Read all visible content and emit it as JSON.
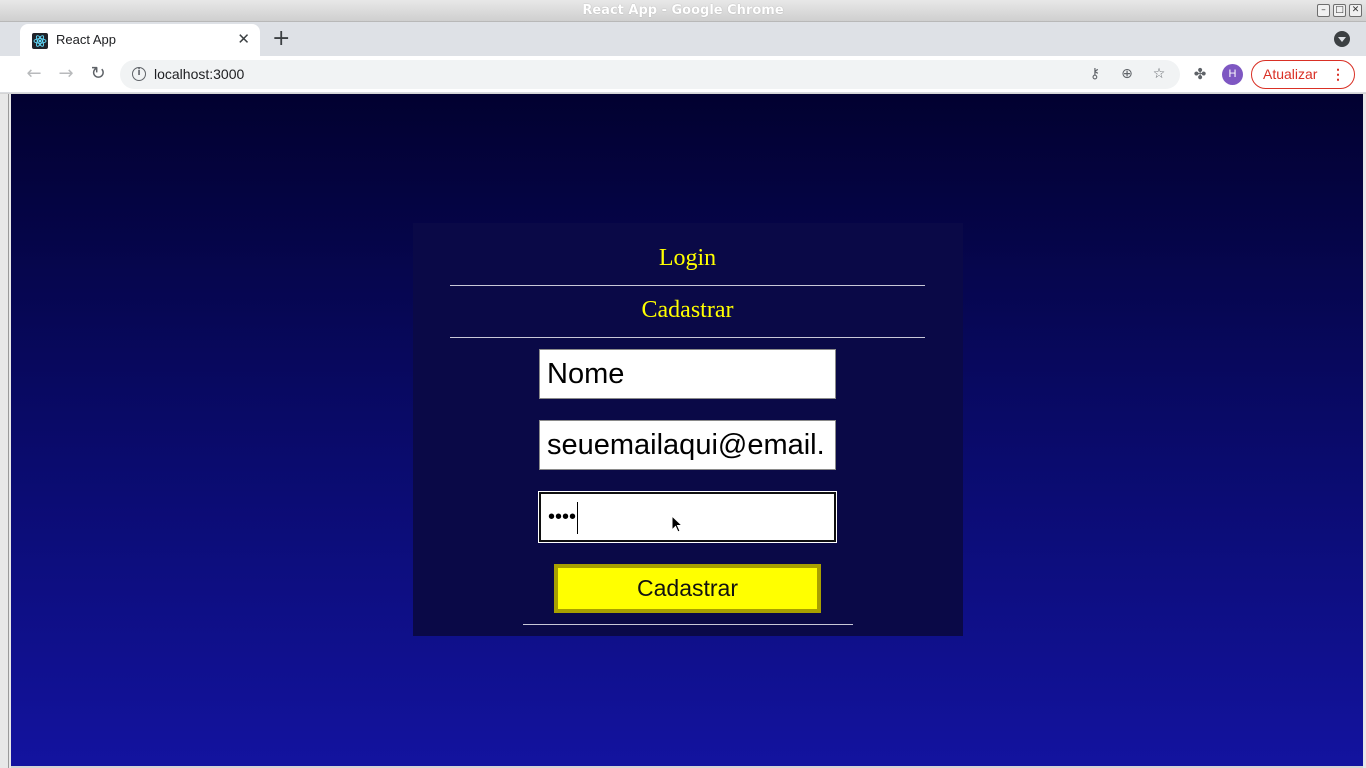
{
  "window": {
    "title": "React App - Google Chrome"
  },
  "browser": {
    "tab_title": "React App",
    "new_tab": "+",
    "close_tab": "✕",
    "url": "localhost:3000",
    "update_label": "Atualizar",
    "avatar_letter": "H"
  },
  "page": {
    "login_link": "Login",
    "signup_link": "Cadastrar",
    "name_value": "Nome",
    "email_value": "seuemailaqui@email.",
    "password_mask": "••••",
    "submit_label": "Cadastrar"
  },
  "colors": {
    "accent": "#ffff00",
    "card": "#0a0947",
    "update": "#d93025"
  }
}
